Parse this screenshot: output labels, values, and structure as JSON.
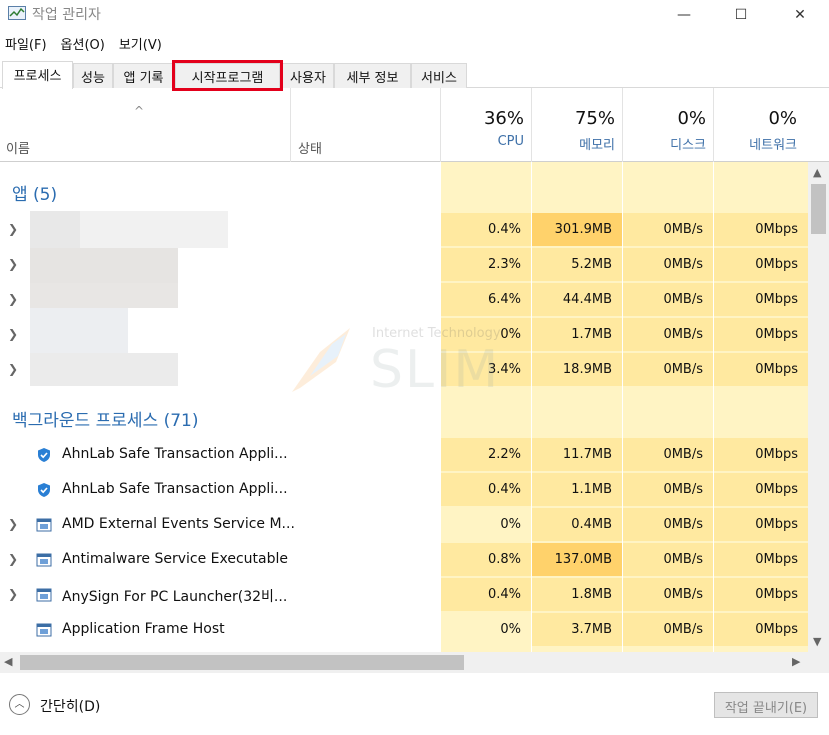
{
  "window": {
    "title": "작업 관리자",
    "minimize_icon": "—",
    "maximize_icon": "☐",
    "close_icon": "✕"
  },
  "menu": [
    "파일(F)",
    "옵션(O)",
    "보기(V)"
  ],
  "tabs": [
    {
      "label": "프로세스",
      "active": true
    },
    {
      "label": "성능"
    },
    {
      "label": "앱 기록"
    },
    {
      "label": "시작프로그램",
      "highlighted": true
    },
    {
      "label": "사용자"
    },
    {
      "label": "세부 정보"
    },
    {
      "label": "서비스"
    }
  ],
  "columns": {
    "sort_indicator": "^",
    "name": "이름",
    "status": "상태",
    "cpu": {
      "percent": "36%",
      "label": "CPU"
    },
    "memory": {
      "percent": "75%",
      "label": "메모리"
    },
    "disk": {
      "percent": "0%",
      "label": "디스크"
    },
    "network": {
      "percent": "0%",
      "label": "네트워크"
    }
  },
  "groups": {
    "apps": "앱 (5)",
    "background": "백그라운드 프로세스 (71)"
  },
  "apps": [
    {
      "cpu": "0.4%",
      "memory": "301.9MB",
      "disk": "0MB/s",
      "network": "0Mbps"
    },
    {
      "cpu": "2.3%",
      "memory": "5.2MB",
      "disk": "0MB/s",
      "network": "0Mbps"
    },
    {
      "cpu": "6.4%",
      "memory": "44.4MB",
      "disk": "0MB/s",
      "network": "0Mbps"
    },
    {
      "cpu": "0%",
      "memory": "1.7MB",
      "disk": "0MB/s",
      "network": "0Mbps"
    },
    {
      "cpu": "3.4%",
      "memory": "18.9MB",
      "disk": "0MB/s",
      "network": "0Mbps"
    }
  ],
  "processes": [
    {
      "name": "AhnLab Safe Transaction Appli...",
      "icon": "shield-icon",
      "cpu": "2.2%",
      "memory": "11.7MB",
      "disk": "0MB/s",
      "network": "0Mbps"
    },
    {
      "name": "AhnLab Safe Transaction Appli...",
      "icon": "shield-icon",
      "cpu": "0.4%",
      "memory": "1.1MB",
      "disk": "0MB/s",
      "network": "0Mbps"
    },
    {
      "name": "AMD External Events Service M...",
      "icon": "service-icon",
      "cpu": "0%",
      "memory": "0.4MB",
      "disk": "0MB/s",
      "network": "0Mbps"
    },
    {
      "name": "Antimalware Service Executable",
      "icon": "service-icon",
      "cpu": "0.8%",
      "memory": "137.0MB",
      "disk": "0MB/s",
      "network": "0Mbps"
    },
    {
      "name": "AnySign For PC Launcher(32비...",
      "icon": "service-icon",
      "cpu": "0.4%",
      "memory": "1.8MB",
      "disk": "0MB/s",
      "network": "0Mbps"
    },
    {
      "name": "Application Frame Host",
      "icon": "service-icon",
      "cpu": "0%",
      "memory": "3.7MB",
      "disk": "0MB/s",
      "network": "0Mbps"
    }
  ],
  "watermark": {
    "small": "Internet Technology",
    "big": "SLIM"
  },
  "footer": {
    "fewer_details": "간단히(D)",
    "end_task": "작업 끝내기(E)"
  },
  "colors": {
    "heat_low": "#fff4c4",
    "heat_mid": "#ffe9a0",
    "heat_high": "#ffd26b",
    "group_title": "#2b6cb0",
    "highlight_border": "#e3001b"
  }
}
